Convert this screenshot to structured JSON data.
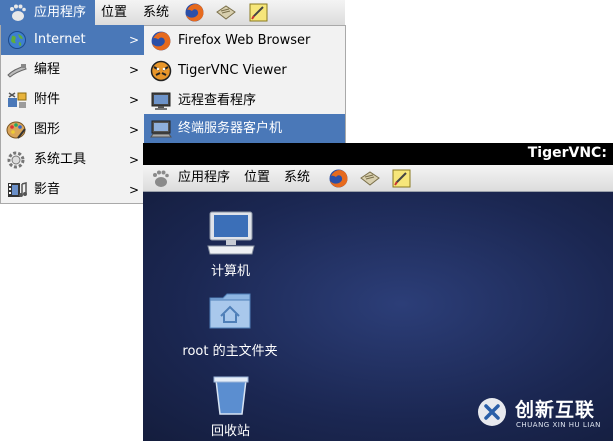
{
  "top_panel": {
    "apps_label": "应用程序",
    "places_label": "位置",
    "system_label": "系统"
  },
  "main_menu": {
    "items": [
      {
        "label": "Internet",
        "icon": "globe-icon",
        "selected": true
      },
      {
        "label": "编程",
        "icon": "programming-icon"
      },
      {
        "label": "附件",
        "icon": "accessories-icon"
      },
      {
        "label": "图形",
        "icon": "graphics-icon"
      },
      {
        "label": "系统工具",
        "icon": "system-tools-icon"
      },
      {
        "label": "影音",
        "icon": "media-icon"
      }
    ]
  },
  "internet_submenu": {
    "items": [
      {
        "label": "Firefox Web Browser",
        "icon": "firefox-icon"
      },
      {
        "label": "TigerVNC Viewer",
        "icon": "tigervnc-icon"
      },
      {
        "label": "远程查看程序",
        "icon": "remote-viewer-icon"
      },
      {
        "label": "终端服务器客户机",
        "icon": "terminal-server-icon",
        "selected": true
      }
    ]
  },
  "vnc_window": {
    "title": "TigerVNC: I",
    "panel": {
      "apps_label": "应用程序",
      "places_label": "位置",
      "system_label": "系统"
    },
    "desktop_icons": [
      {
        "label": "计算机",
        "icon": "computer-icon"
      },
      {
        "label": "root 的主文件夹",
        "icon": "home-folder-icon"
      },
      {
        "label": "回收站",
        "icon": "trash-icon"
      }
    ]
  },
  "watermark": {
    "brand": "创新互联",
    "sub": "CHUANG XIN HU LIAN"
  },
  "colors": {
    "selection": "#4a78b8",
    "desktop": "#1c2a52",
    "menu_bg": "#f2f2f2"
  }
}
